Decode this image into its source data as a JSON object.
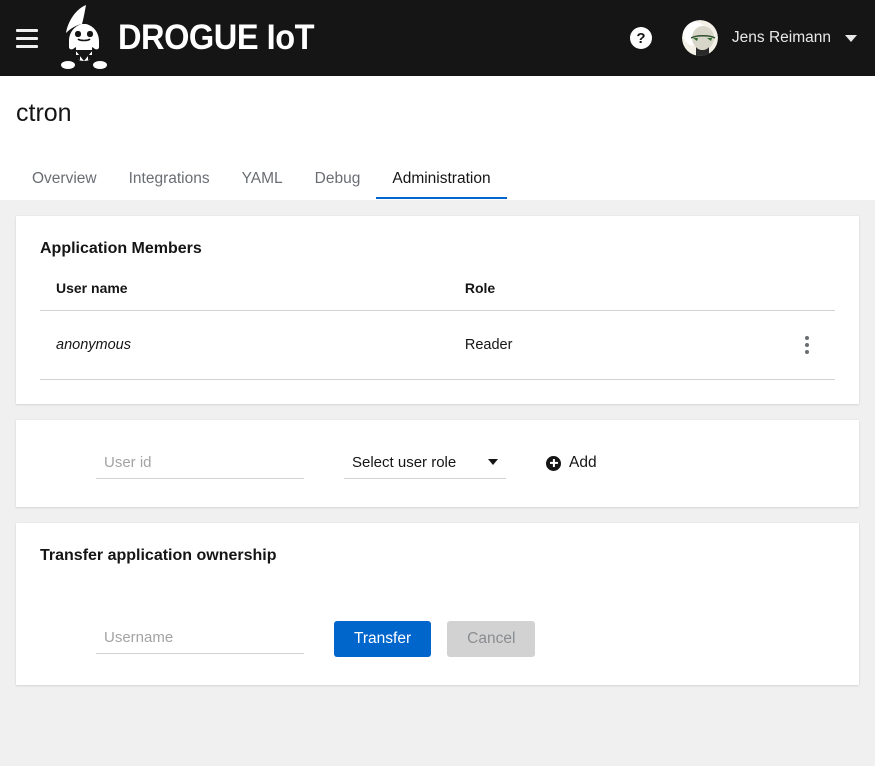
{
  "masthead": {
    "menu_toggle_label": "Global navigation",
    "brand_text": "DROGUE IoT",
    "brand_logo_name": "drogue-gnome-logo",
    "help_label": "?",
    "user_name": "Jens Reimann"
  },
  "page": {
    "title": "ctron",
    "tabs": [
      {
        "label": "Overview",
        "active": false
      },
      {
        "label": "Integrations",
        "active": false
      },
      {
        "label": "YAML",
        "active": false
      },
      {
        "label": "Debug",
        "active": false
      },
      {
        "label": "Administration",
        "active": true
      }
    ]
  },
  "members_card": {
    "title": "Application Members",
    "columns": [
      "User name",
      "Role"
    ],
    "rows": [
      {
        "username": "anonymous",
        "role": "Reader"
      }
    ]
  },
  "add_member_card": {
    "user_id_placeholder": "User id",
    "user_id_value": "",
    "role_select_label": "Select user role",
    "add_label": "Add"
  },
  "transfer_card": {
    "title": "Transfer application ownership",
    "username_placeholder": "Username",
    "username_value": "",
    "transfer_label": "Transfer",
    "cancel_label": "Cancel"
  },
  "colors": {
    "masthead_bg": "#151515",
    "accent_blue": "#0066cc",
    "page_bg": "#f0f0f0",
    "card_bg": "#ffffff",
    "border": "#d2d2d2",
    "muted_text": "#6a6e73",
    "disabled_bg": "#d2d2d2"
  }
}
